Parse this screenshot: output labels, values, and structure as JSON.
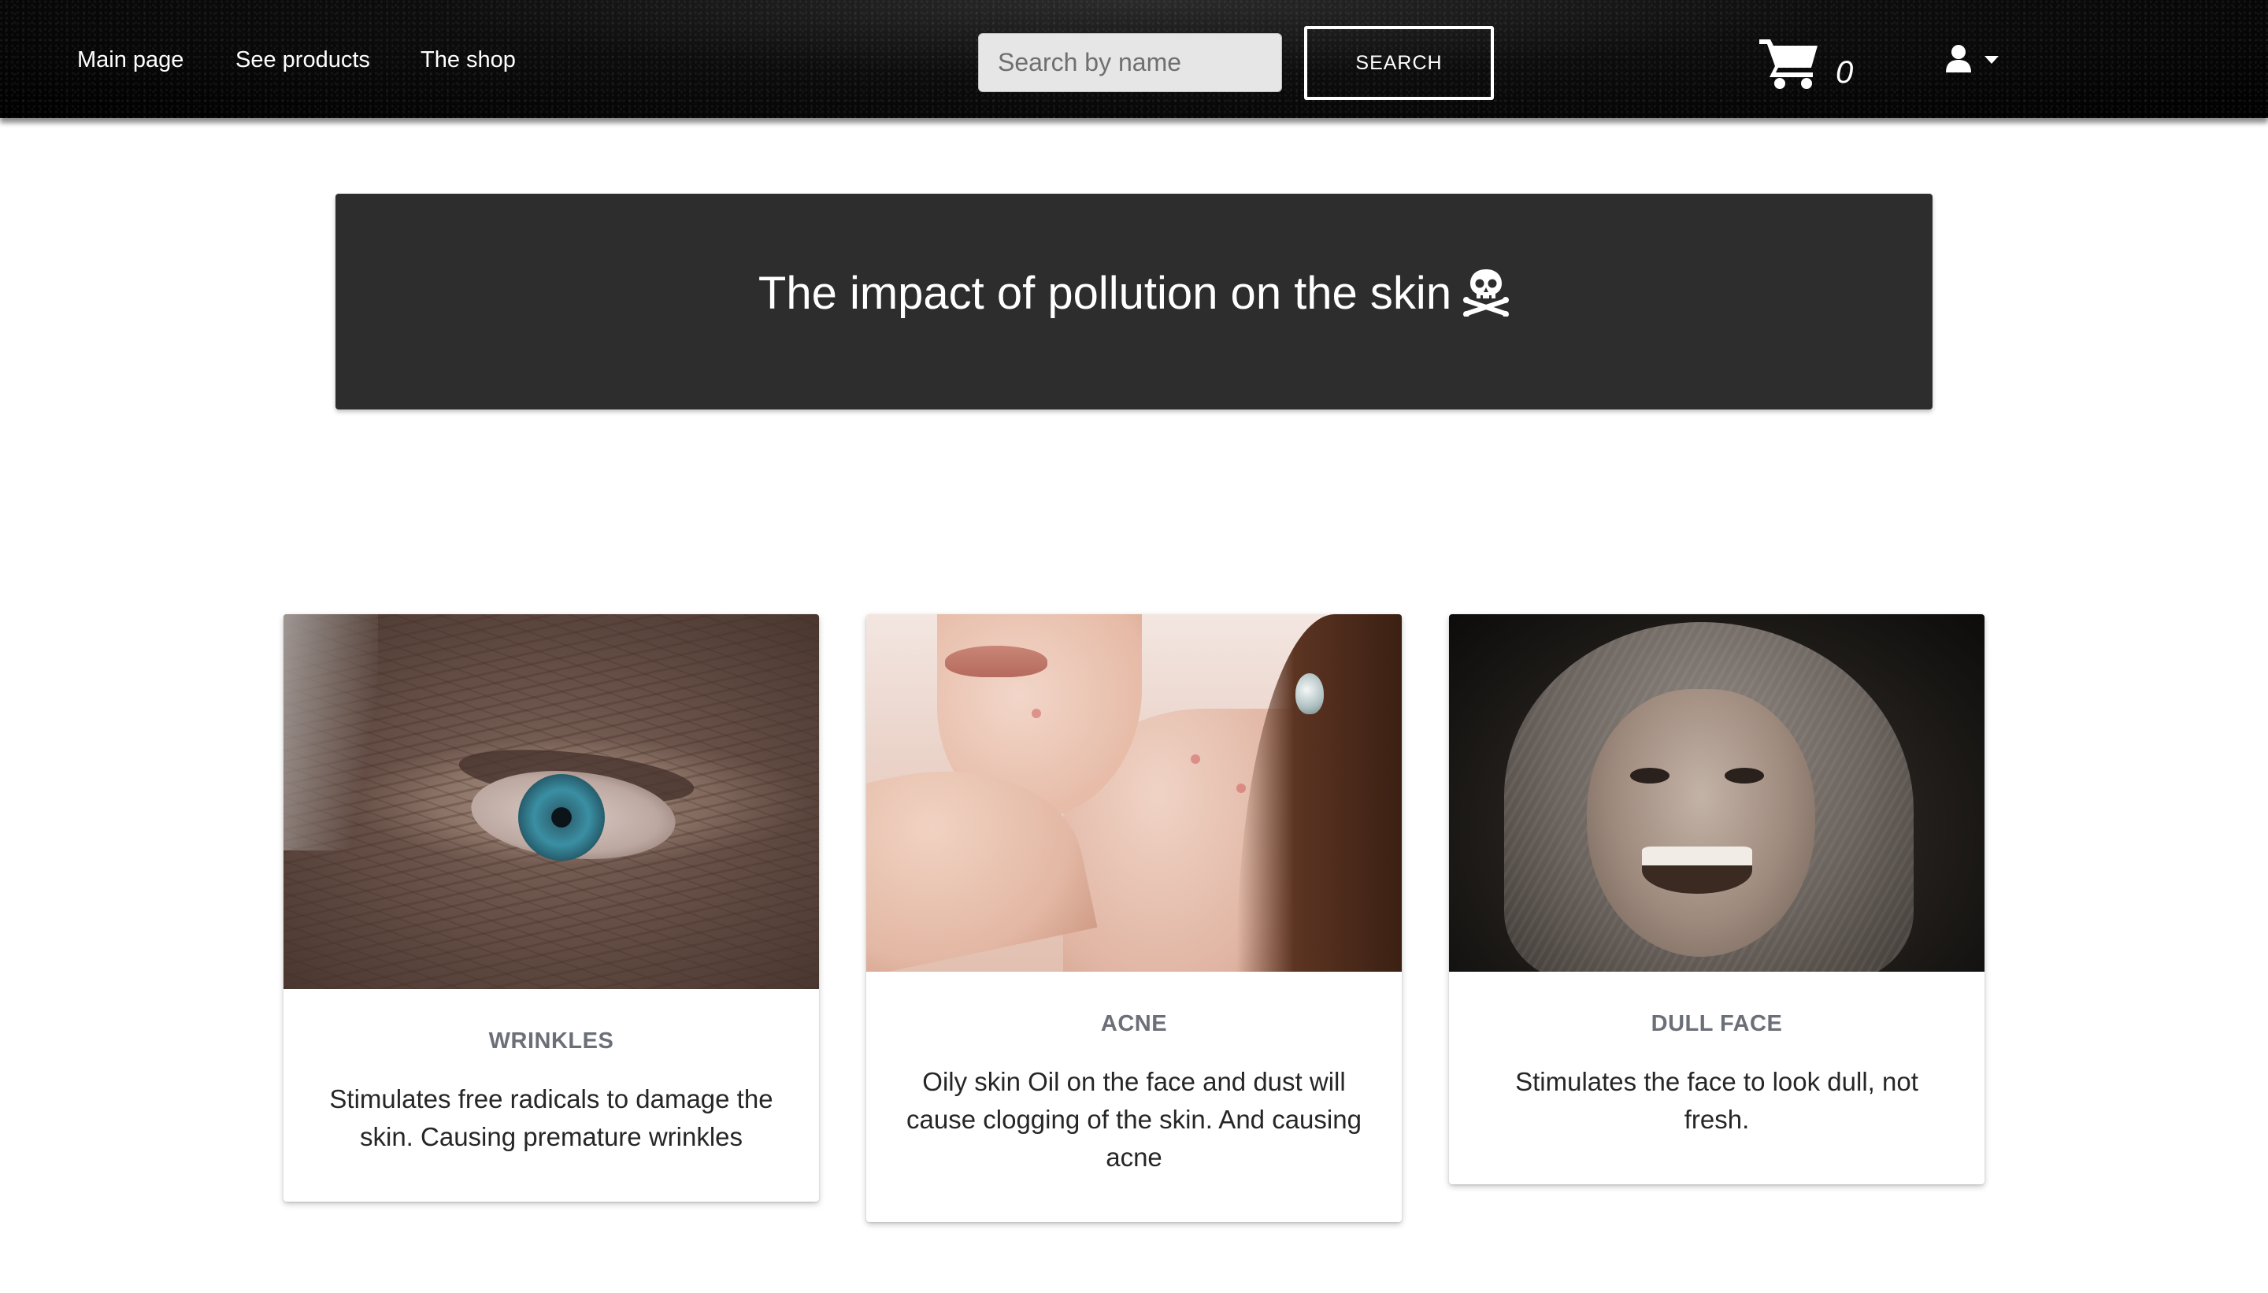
{
  "nav": {
    "links": [
      {
        "label": "Main page"
      },
      {
        "label": "See products"
      },
      {
        "label": "The shop"
      }
    ],
    "search": {
      "placeholder": "Search by name",
      "value": "",
      "button_label": "SEARCH"
    },
    "cart": {
      "icon": "shopping-cart-icon",
      "count": "0"
    },
    "user": {
      "icon": "user-icon",
      "dropdown_icon": "caret-down-icon"
    }
  },
  "banner": {
    "title": "The impact of pollution on the skin",
    "icon": "skull-crossbones-icon",
    "background": "#2d2d2d"
  },
  "cards": [
    {
      "title": "WRINKLES",
      "text": "Stimulates free radicals to damage the skin. Causing premature wrinkles",
      "image": "close-up of an aged wrinkled eye"
    },
    {
      "title": "ACNE",
      "text": "Oily skin Oil on the face and dust will cause clogging of the skin. And causing acne",
      "image": "woman touching chin with acne spots"
    },
    {
      "title": "DULL FACE",
      "text": "Stimulates the face to look dull, not fresh.",
      "image": "smiling child with towel over head"
    }
  ],
  "colors": {
    "navbar": "#000000",
    "card_title": "#6b6f78",
    "card_text": "#262626"
  }
}
